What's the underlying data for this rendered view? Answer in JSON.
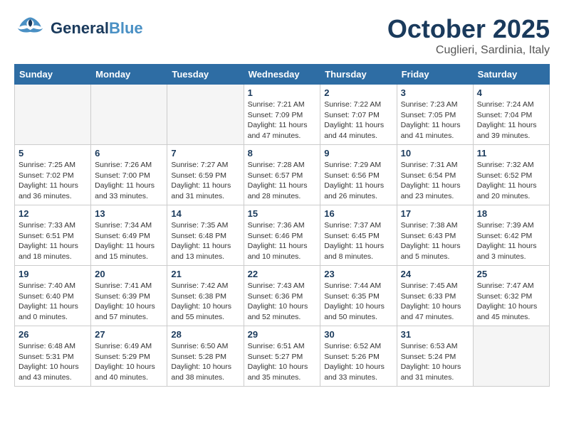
{
  "header": {
    "logo_general": "General",
    "logo_blue": "Blue",
    "month": "October 2025",
    "location": "Cuglieri, Sardinia, Italy"
  },
  "days_of_week": [
    "Sunday",
    "Monday",
    "Tuesday",
    "Wednesday",
    "Thursday",
    "Friday",
    "Saturday"
  ],
  "weeks": [
    [
      {
        "day": "",
        "info": ""
      },
      {
        "day": "",
        "info": ""
      },
      {
        "day": "",
        "info": ""
      },
      {
        "day": "1",
        "info": "Sunrise: 7:21 AM\nSunset: 7:09 PM\nDaylight: 11 hours\nand 47 minutes."
      },
      {
        "day": "2",
        "info": "Sunrise: 7:22 AM\nSunset: 7:07 PM\nDaylight: 11 hours\nand 44 minutes."
      },
      {
        "day": "3",
        "info": "Sunrise: 7:23 AM\nSunset: 7:05 PM\nDaylight: 11 hours\nand 41 minutes."
      },
      {
        "day": "4",
        "info": "Sunrise: 7:24 AM\nSunset: 7:04 PM\nDaylight: 11 hours\nand 39 minutes."
      }
    ],
    [
      {
        "day": "5",
        "info": "Sunrise: 7:25 AM\nSunset: 7:02 PM\nDaylight: 11 hours\nand 36 minutes."
      },
      {
        "day": "6",
        "info": "Sunrise: 7:26 AM\nSunset: 7:00 PM\nDaylight: 11 hours\nand 33 minutes."
      },
      {
        "day": "7",
        "info": "Sunrise: 7:27 AM\nSunset: 6:59 PM\nDaylight: 11 hours\nand 31 minutes."
      },
      {
        "day": "8",
        "info": "Sunrise: 7:28 AM\nSunset: 6:57 PM\nDaylight: 11 hours\nand 28 minutes."
      },
      {
        "day": "9",
        "info": "Sunrise: 7:29 AM\nSunset: 6:56 PM\nDaylight: 11 hours\nand 26 minutes."
      },
      {
        "day": "10",
        "info": "Sunrise: 7:31 AM\nSunset: 6:54 PM\nDaylight: 11 hours\nand 23 minutes."
      },
      {
        "day": "11",
        "info": "Sunrise: 7:32 AM\nSunset: 6:52 PM\nDaylight: 11 hours\nand 20 minutes."
      }
    ],
    [
      {
        "day": "12",
        "info": "Sunrise: 7:33 AM\nSunset: 6:51 PM\nDaylight: 11 hours\nand 18 minutes."
      },
      {
        "day": "13",
        "info": "Sunrise: 7:34 AM\nSunset: 6:49 PM\nDaylight: 11 hours\nand 15 minutes."
      },
      {
        "day": "14",
        "info": "Sunrise: 7:35 AM\nSunset: 6:48 PM\nDaylight: 11 hours\nand 13 minutes."
      },
      {
        "day": "15",
        "info": "Sunrise: 7:36 AM\nSunset: 6:46 PM\nDaylight: 11 hours\nand 10 minutes."
      },
      {
        "day": "16",
        "info": "Sunrise: 7:37 AM\nSunset: 6:45 PM\nDaylight: 11 hours\nand 8 minutes."
      },
      {
        "day": "17",
        "info": "Sunrise: 7:38 AM\nSunset: 6:43 PM\nDaylight: 11 hours\nand 5 minutes."
      },
      {
        "day": "18",
        "info": "Sunrise: 7:39 AM\nSunset: 6:42 PM\nDaylight: 11 hours\nand 3 minutes."
      }
    ],
    [
      {
        "day": "19",
        "info": "Sunrise: 7:40 AM\nSunset: 6:40 PM\nDaylight: 11 hours\nand 0 minutes."
      },
      {
        "day": "20",
        "info": "Sunrise: 7:41 AM\nSunset: 6:39 PM\nDaylight: 10 hours\nand 57 minutes."
      },
      {
        "day": "21",
        "info": "Sunrise: 7:42 AM\nSunset: 6:38 PM\nDaylight: 10 hours\nand 55 minutes."
      },
      {
        "day": "22",
        "info": "Sunrise: 7:43 AM\nSunset: 6:36 PM\nDaylight: 10 hours\nand 52 minutes."
      },
      {
        "day": "23",
        "info": "Sunrise: 7:44 AM\nSunset: 6:35 PM\nDaylight: 10 hours\nand 50 minutes."
      },
      {
        "day": "24",
        "info": "Sunrise: 7:45 AM\nSunset: 6:33 PM\nDaylight: 10 hours\nand 47 minutes."
      },
      {
        "day": "25",
        "info": "Sunrise: 7:47 AM\nSunset: 6:32 PM\nDaylight: 10 hours\nand 45 minutes."
      }
    ],
    [
      {
        "day": "26",
        "info": "Sunrise: 6:48 AM\nSunset: 5:31 PM\nDaylight: 10 hours\nand 43 minutes."
      },
      {
        "day": "27",
        "info": "Sunrise: 6:49 AM\nSunset: 5:29 PM\nDaylight: 10 hours\nand 40 minutes."
      },
      {
        "day": "28",
        "info": "Sunrise: 6:50 AM\nSunset: 5:28 PM\nDaylight: 10 hours\nand 38 minutes."
      },
      {
        "day": "29",
        "info": "Sunrise: 6:51 AM\nSunset: 5:27 PM\nDaylight: 10 hours\nand 35 minutes."
      },
      {
        "day": "30",
        "info": "Sunrise: 6:52 AM\nSunset: 5:26 PM\nDaylight: 10 hours\nand 33 minutes."
      },
      {
        "day": "31",
        "info": "Sunrise: 6:53 AM\nSunset: 5:24 PM\nDaylight: 10 hours\nand 31 minutes."
      },
      {
        "day": "",
        "info": ""
      }
    ]
  ]
}
